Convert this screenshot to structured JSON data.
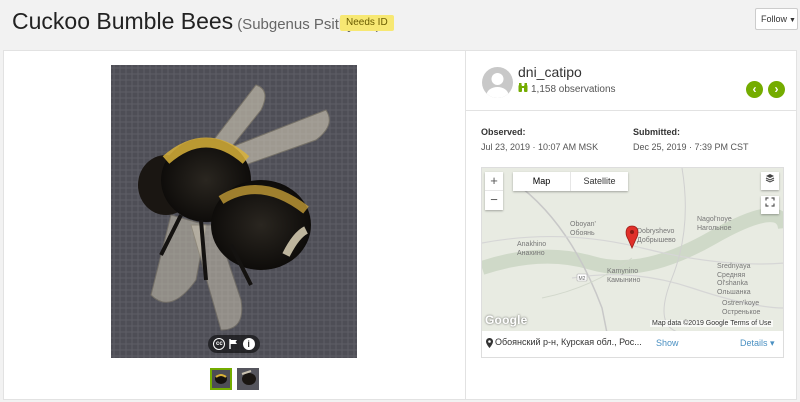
{
  "header": {
    "title": "Cuckoo Bumble Bees",
    "subtitle": "(Subgenus Psithyrus)",
    "badge": "Needs ID",
    "follow_label": "Follow"
  },
  "observer": {
    "username": "dni_catipo",
    "observations": "1,158 observations"
  },
  "dates": {
    "observed_label": "Observed:",
    "observed_value": "Jul 23, 2019 · 10:07 AM MSK",
    "submitted_label": "Submitted:",
    "submitted_value": "Dec 25, 2019 · 7:39 PM CST"
  },
  "map": {
    "type_map": "Map",
    "type_satellite": "Satellite",
    "zoom_in": "+",
    "zoom_out": "−",
    "google": "Google",
    "attribution": "Map data ©2019 Google  Terms of Use",
    "towns": [
      {
        "name": "Oboyan'",
        "name2": "Обоянь"
      },
      {
        "name": "Anakhino",
        "name2": "Анахино"
      },
      {
        "name": "Dobryshevo",
        "name2": "Добрышево"
      },
      {
        "name": "Nagol'noye",
        "name2": "Нагольное"
      },
      {
        "name": "Kamynino",
        "name2": "Камынино"
      },
      {
        "name": "Srednyaya",
        "name2": "Средняя"
      },
      {
        "name": "Ol'shanka",
        "name2": "Ольшанка"
      },
      {
        "name": "Ostren'koye",
        "name2": "Остренькое"
      }
    ],
    "road_label": "M2"
  },
  "place": {
    "text": "Обоянский р-н, Курская обл., Рос...",
    "show": "Show",
    "details": "Details ▾"
  },
  "icons": {
    "cc": "cc-icon",
    "flag": "flag-icon",
    "info": "info-icon",
    "prev": "chevron-left-icon",
    "next": "chevron-right-icon",
    "layers": "layers-icon",
    "fullscreen": "fullscreen-icon",
    "pin": "map-pin-icon"
  },
  "colors": {
    "accent": "#74ac00",
    "badge_bg": "#f7e873",
    "link": "#4a90c2",
    "marker": "#e0302a"
  }
}
